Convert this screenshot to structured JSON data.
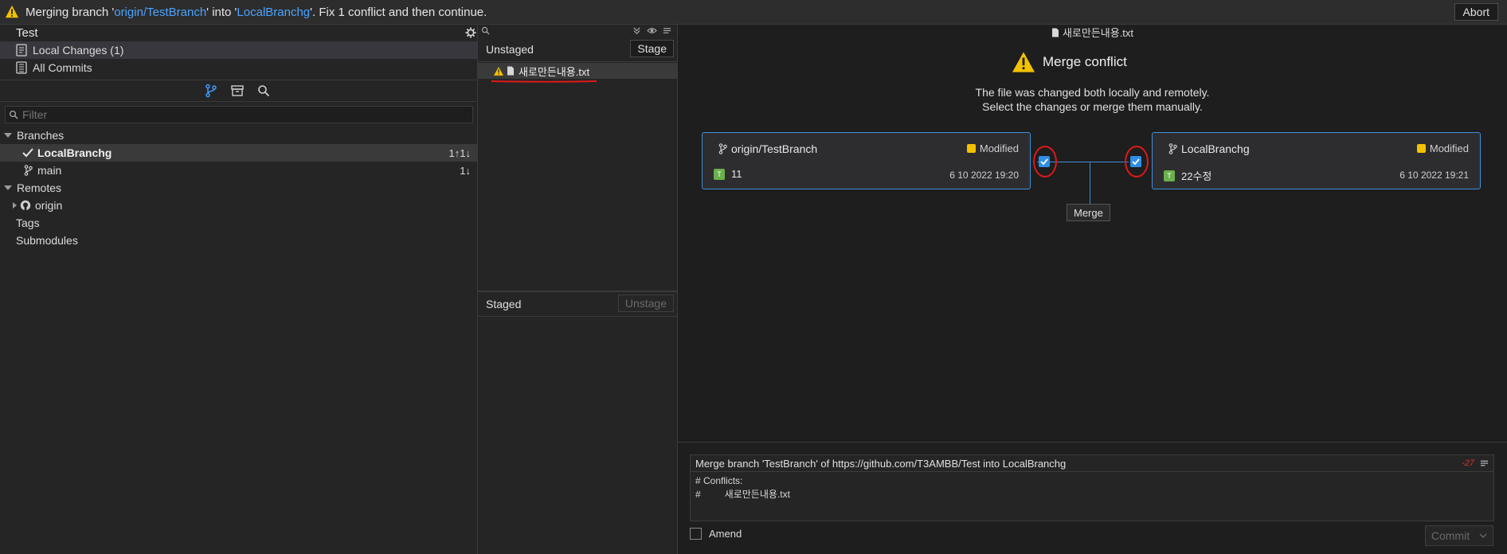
{
  "banner": {
    "prefix": "Merging branch '",
    "source_branch": "origin/TestBranch",
    "middle": "' into '",
    "target_branch": "LocalBranchg",
    "suffix": "'. Fix 1 conflict and then continue.",
    "abort_label": "Abort"
  },
  "repo": {
    "title": "Test",
    "local_changes_label": "Local Changes (1)",
    "all_commits_label": "All Commits"
  },
  "filter": {
    "placeholder": "Filter"
  },
  "tree": {
    "branches_label": "Branches",
    "branches": [
      {
        "name": "LocalBranchg",
        "counts": "1↑1↓",
        "current": true
      },
      {
        "name": "main",
        "counts": "1↓",
        "current": false
      }
    ],
    "remotes_label": "Remotes",
    "remote_origin": "origin",
    "tags_label": "Tags",
    "submodules_label": "Submodules"
  },
  "unstaged": {
    "title": "Unstaged",
    "stage_label": "Stage",
    "file": "새로만든내용.txt"
  },
  "staged": {
    "title": "Staged",
    "unstage_label": "Unstage"
  },
  "conflict": {
    "file_title": "새로만든내용.txt",
    "heading": "Merge conflict",
    "desc_line1": "The file was changed both locally and remotely.",
    "desc_line2": "Select the changes or merge them manually.",
    "left": {
      "branch": "origin/TestBranch",
      "status": "Modified",
      "badge": "T",
      "commit": "11",
      "date": "6 10 2022 19:20"
    },
    "right": {
      "branch": "LocalBranchg",
      "status": "Modified",
      "badge": "T",
      "commit": "22수정",
      "date": "6 10 2022 19:21"
    },
    "merge_label": "Merge"
  },
  "commit": {
    "summary": "Merge branch 'TestBranch' of https://github.com/T3AMBB/Test into LocalBranchg",
    "remaining": "-27",
    "body": "# Conflicts:\n#         새로만든내용.txt",
    "amend_label": "Amend",
    "commit_label": "Commit"
  },
  "colors": {
    "accent": "#3e8fdc",
    "link": "#4aa3ff",
    "warning": "#f2c200",
    "annotation_red": "#e01818"
  }
}
